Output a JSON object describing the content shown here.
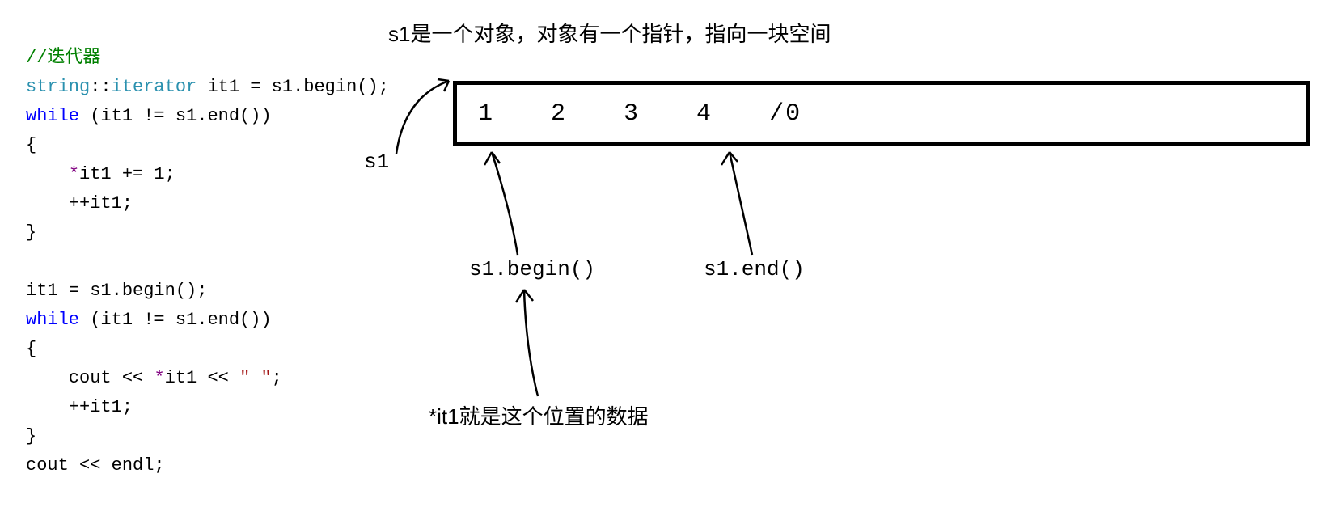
{
  "code": {
    "comment": "//迭代器",
    "l1_type": "string",
    "l1_dcolon": "::",
    "l1_iterator": "iterator",
    "l1_rest": " it1 = s1.begin();",
    "l2_kw": "while",
    "l2_rest": " (it1 != s1.end())",
    "l3": "{",
    "l4_op": "*",
    "l4_rest": "it1 += 1;",
    "l5": "    ++it1;",
    "l6": "}",
    "l8": "it1 = s1.begin();",
    "l9_kw": "while",
    "l9_rest": " (it1 != s1.end())",
    "l10": "{",
    "l11_a": "    cout << ",
    "l11_op": "*",
    "l11_b": "it1 << ",
    "l11_str": "\" \"",
    "l11_c": ";",
    "l12": "    ++it1;",
    "l13": "}",
    "l14": "cout << endl;"
  },
  "diagram": {
    "title": "s1是一个对象，对象有一个指针，指向一块空间",
    "s1": "s1",
    "mem": [
      "1",
      "2",
      "3",
      "4",
      "/0"
    ],
    "begin": "s1.begin()",
    "end": "s1.end()",
    "deref": "*it1就是这个位置的数据"
  }
}
